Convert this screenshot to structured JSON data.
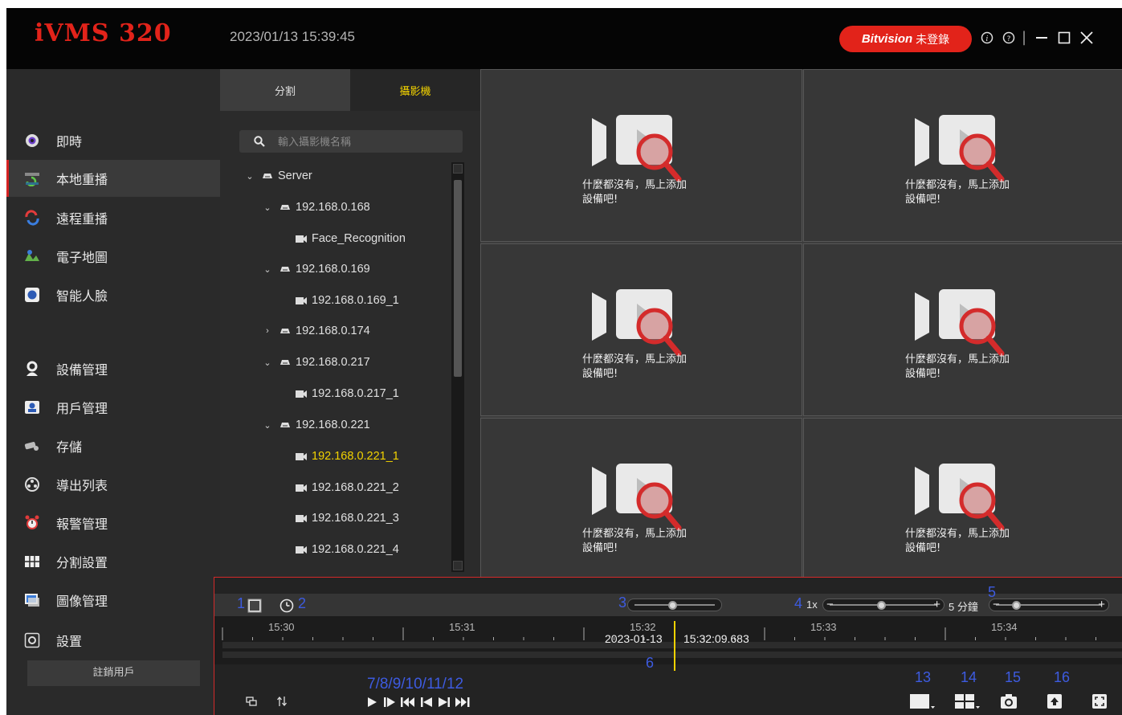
{
  "app": {
    "title": "iVMS 320",
    "datetime": "2023/01/13 15:39:45"
  },
  "header": {
    "brand": "Bitvision",
    "login_status": "未登錄",
    "info_icon": "info-icon",
    "help_icon": "help-icon",
    "controls": [
      "minimize",
      "maximize",
      "close"
    ]
  },
  "sidebar": {
    "items": [
      {
        "label": "即時",
        "icon": "live-icon",
        "active": false
      },
      {
        "label": "本地重播",
        "icon": "local-playback-icon",
        "active": true
      },
      {
        "label": "遠程重播",
        "icon": "remote-playback-icon",
        "active": false
      },
      {
        "label": "電子地圖",
        "icon": "emap-icon",
        "active": false
      },
      {
        "label": "智能人臉",
        "icon": "face-icon",
        "active": false
      },
      {
        "label": "設備管理",
        "icon": "device-icon",
        "active": false
      },
      {
        "label": "用戶管理",
        "icon": "user-icon",
        "active": false
      },
      {
        "label": "存儲",
        "icon": "storage-icon",
        "active": false
      },
      {
        "label": "導出列表",
        "icon": "export-icon",
        "active": false
      },
      {
        "label": "報警管理",
        "icon": "alarm-icon",
        "active": false
      },
      {
        "label": "分割設置",
        "icon": "split-icon",
        "active": false
      },
      {
        "label": "圖像管理",
        "icon": "image-icon",
        "active": false
      },
      {
        "label": "設置",
        "icon": "settings-icon",
        "active": false
      }
    ],
    "logout": "註銷用戶"
  },
  "tree_panel": {
    "tabs": [
      {
        "label": "分割"
      },
      {
        "label": "攝影機",
        "active": true
      }
    ],
    "search_placeholder": "輸入攝影機名稱",
    "rows": [
      {
        "text": "Server",
        "type": "server",
        "chevron": "⌄"
      },
      {
        "text": "192.168.0.168",
        "type": "device",
        "chevron": "⌄"
      },
      {
        "text": "Face_Recognition",
        "type": "camera"
      },
      {
        "text": "192.168.0.169",
        "type": "device",
        "chevron": "⌄"
      },
      {
        "text": "192.168.0.169_1",
        "type": "camera"
      },
      {
        "text": "192.168.0.174",
        "type": "device",
        "chevron": "›"
      },
      {
        "text": "192.168.0.217",
        "type": "device",
        "chevron": "⌄"
      },
      {
        "text": "192.168.0.217_1",
        "type": "camera"
      },
      {
        "text": "192.168.0.221",
        "type": "device",
        "chevron": "⌄"
      },
      {
        "text": "192.168.0.221_1",
        "type": "camera",
        "selected": true
      },
      {
        "text": "192.168.0.221_2",
        "type": "camera"
      },
      {
        "text": "192.168.0.221_3",
        "type": "camera"
      },
      {
        "text": "192.168.0.221_4",
        "type": "camera"
      }
    ]
  },
  "video_grid": {
    "empty_line1": "什麼都沒有，馬上添加",
    "empty_line2": "設備吧!",
    "cell_count": 6
  },
  "playback": {
    "annotations": {
      "a1": "1",
      "a2": "2",
      "a3": "3",
      "a4": "4",
      "a5": "5",
      "a6": "6",
      "a7": "7/8/9/10/11/12",
      "a13": "13",
      "a14": "14",
      "a15": "15",
      "a16": "16"
    },
    "speed_label": "1x",
    "minus": "−",
    "plus": "+",
    "span_label": "5 分鐘",
    "speed_level": 0.5,
    "span_level": 0.15,
    "volume_level": 0.5,
    "ticks": [
      "15:30",
      "15:31",
      "15:32",
      "15:33",
      "15:34"
    ],
    "cursor_date": "2023-01-13",
    "cursor_time": "15:32:09.683"
  },
  "colors": {
    "accent_red": "#e2231a",
    "selected_yellow": "#f2d200",
    "annotation_blue": "#3d5be0"
  }
}
